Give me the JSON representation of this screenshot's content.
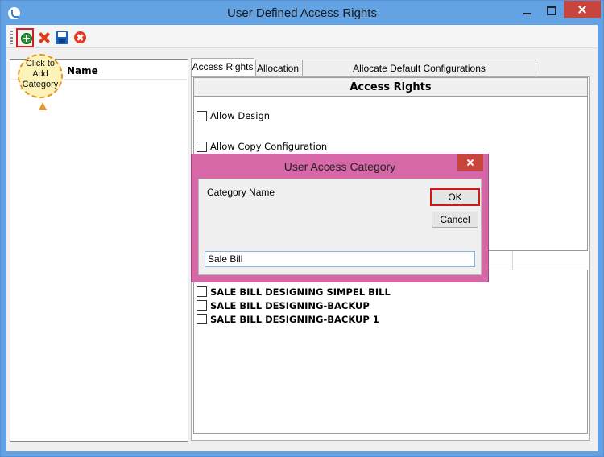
{
  "window": {
    "title": "User Defined Access Rights"
  },
  "toolbar": {
    "callout": "Click to\nAdd\nCategory",
    "buttons": [
      "add-category",
      "delete",
      "save",
      "cancel"
    ]
  },
  "list": {
    "header": "Name"
  },
  "tabs": [
    {
      "label": "Access Rights",
      "selected": true
    },
    {
      "label": "Allocation",
      "selected": false
    },
    {
      "label": "Allocate Default Configurations",
      "selected": false
    }
  ],
  "access_rights": {
    "title": "Access Rights",
    "allow_design": {
      "label": "Allow Design",
      "checked": false
    },
    "allow_copy": {
      "label": "Allow Copy Configuration",
      "checked": false
    }
  },
  "rows": [
    {
      "label": "SALE BILL DESIGNING SIMPEL BILL",
      "checked": false
    },
    {
      "label": "SALE BILL DESIGNING-BACKUP",
      "checked": false
    },
    {
      "label": "SALE BILL DESIGNING-BACKUP 1",
      "checked": false
    }
  ],
  "dialog": {
    "title": "User Access Category",
    "field_label": "Category Name",
    "ok_label": "OK",
    "cancel_label": "Cancel",
    "category_value": "Sale Bill"
  },
  "colors": {
    "titlebar": "#63a3e3",
    "dialog": "#d668a7",
    "close": "#c7453d",
    "highlight": "#d01818"
  }
}
